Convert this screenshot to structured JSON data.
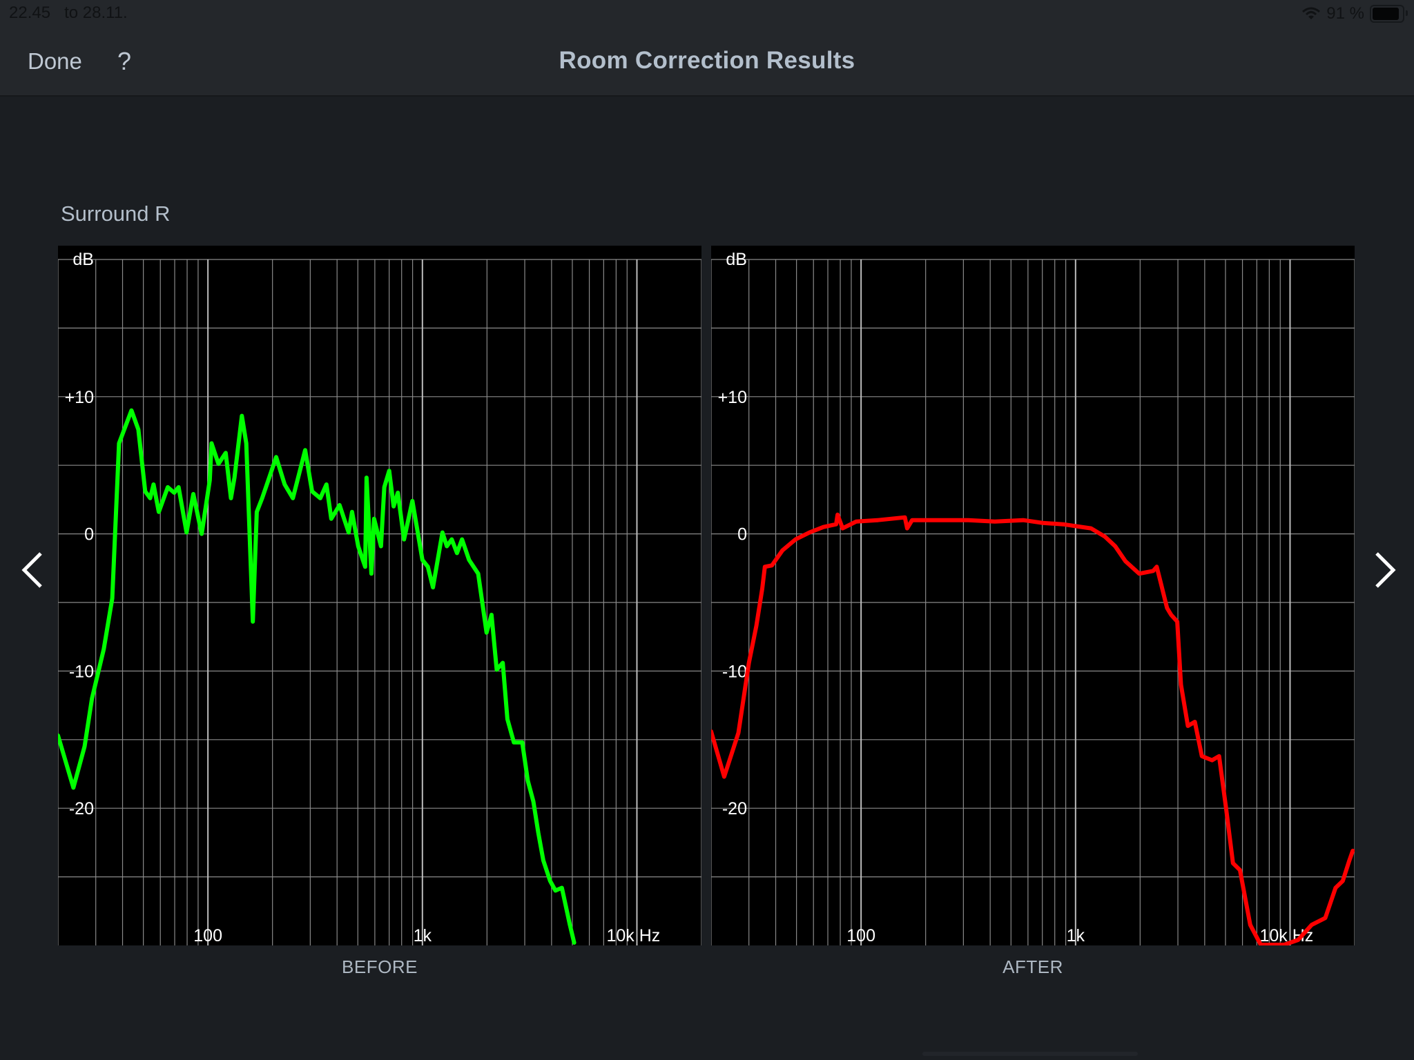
{
  "status_bar": {
    "time": "22.45",
    "date": "to 28.11.",
    "battery_percent_label": "91 %",
    "battery_level": 0.91,
    "icons": [
      "wifi-icon",
      "battery-icon"
    ]
  },
  "nav": {
    "done_label": "Done",
    "help_label": "?",
    "title": "Room Correction Results"
  },
  "channel": {
    "name": "Surround R"
  },
  "navigation": {
    "prev_icon": "chevron-left-icon",
    "next_icon": "chevron-right-icon"
  },
  "colors": {
    "before_line": "#00ff00",
    "after_line": "#ff0000",
    "grid": "#8a8a8a",
    "plot_background": "#000000"
  },
  "chart_data": [
    {
      "type": "line",
      "title": "BEFORE",
      "xlabel": "Hz",
      "ylabel": "dB",
      "xscale": "log",
      "xlim": [
        20,
        20000
      ],
      "ylim": [
        -30,
        20
      ],
      "grid": true,
      "x_ticks": [
        {
          "value": 100,
          "label": "100"
        },
        {
          "value": 1000,
          "label": "1k"
        },
        {
          "value": 10000,
          "label": "10k Hz"
        }
      ],
      "y_ticks": [
        {
          "value": 20,
          "label": "dB"
        },
        {
          "value": 10,
          "label": "+10"
        },
        {
          "value": 0,
          "label": "0"
        },
        {
          "value": -10,
          "label": "-10"
        },
        {
          "value": -20,
          "label": "-20"
        }
      ],
      "series": [
        {
          "name": "Before",
          "color": "#00ff00",
          "points": [
            [
              20,
              -14.7
            ],
            [
              23.6,
              -18.5
            ],
            [
              26.6,
              -15.5
            ],
            [
              28.8,
              -12
            ],
            [
              32.7,
              -8.4
            ],
            [
              35.8,
              -4.7
            ],
            [
              38.5,
              6.6
            ],
            [
              44,
              9.0
            ],
            [
              47.4,
              7.6
            ],
            [
              51,
              3.1
            ],
            [
              53.8,
              2.6
            ],
            [
              55.8,
              3.6
            ],
            [
              59,
              1.6
            ],
            [
              65,
              3.4
            ],
            [
              69.6,
              3.0
            ],
            [
              73,
              3.4
            ],
            [
              79.5,
              0.1
            ],
            [
              85.5,
              2.9
            ],
            [
              93.5,
              0
            ],
            [
              102,
              3.9
            ],
            [
              104,
              6.6
            ],
            [
              112,
              5.1
            ],
            [
              121,
              5.9
            ],
            [
              128,
              2.6
            ],
            [
              133,
              4.1
            ],
            [
              144,
              8.6
            ],
            [
              151,
              6.6
            ],
            [
              162,
              -6.4
            ],
            [
              169,
              1.6
            ],
            [
              179,
              2.6
            ],
            [
              193,
              4.1
            ],
            [
              208,
              5.6
            ],
            [
              228,
              3.6
            ],
            [
              249,
              2.6
            ],
            [
              284,
              6.1
            ],
            [
              306,
              3.1
            ],
            [
              334,
              2.6
            ],
            [
              357,
              3.6
            ],
            [
              376,
              1.1
            ],
            [
              411,
              2.1
            ],
            [
              453,
              0.1
            ],
            [
              470,
              1.6
            ],
            [
              502,
              -0.9
            ],
            [
              541,
              -2.4
            ],
            [
              549,
              4.1
            ],
            [
              578,
              -2.9
            ],
            [
              595,
              1.1
            ],
            [
              641,
              -0.9
            ],
            [
              664,
              3.4
            ],
            [
              700,
              4.6
            ],
            [
              734,
              2.0
            ],
            [
              768,
              3.0
            ],
            [
              821,
              -0.4
            ],
            [
              898,
              2.4
            ],
            [
              1000,
              -1.9
            ],
            [
              1060,
              -2.4
            ],
            [
              1120,
              -3.9
            ],
            [
              1240,
              0.1
            ],
            [
              1300,
              -0.9
            ],
            [
              1370,
              -0.4
            ],
            [
              1450,
              -1.4
            ],
            [
              1530,
              -0.4
            ],
            [
              1650,
              -1.9
            ],
            [
              1820,
              -2.9
            ],
            [
              1990,
              -7.2
            ],
            [
              2100,
              -5.9
            ],
            [
              2220,
              -9.9
            ],
            [
              2370,
              -9.4
            ],
            [
              2490,
              -13.5
            ],
            [
              2670,
              -15.2
            ],
            [
              2920,
              -15.2
            ],
            [
              3100,
              -18
            ],
            [
              3290,
              -19.5
            ],
            [
              3470,
              -21.8
            ],
            [
              3660,
              -23.8
            ],
            [
              3940,
              -25.3
            ],
            [
              4170,
              -26
            ],
            [
              4470,
              -25.8
            ],
            [
              4870,
              -28.5
            ],
            [
              5100,
              -29.8
            ]
          ]
        }
      ]
    },
    {
      "type": "line",
      "title": "AFTER",
      "xlabel": "Hz",
      "ylabel": "dB",
      "xscale": "log",
      "xlim": [
        20,
        20000
      ],
      "ylim": [
        -30,
        20
      ],
      "grid": true,
      "x_ticks": [
        {
          "value": 100,
          "label": "100"
        },
        {
          "value": 1000,
          "label": "1k"
        },
        {
          "value": 10000,
          "label": "10k Hz"
        }
      ],
      "y_ticks": [
        {
          "value": 20,
          "label": "dB"
        },
        {
          "value": 10,
          "label": "+10"
        },
        {
          "value": 0,
          "label": "0"
        },
        {
          "value": -10,
          "label": "-10"
        },
        {
          "value": -20,
          "label": "-20"
        }
      ],
      "series": [
        {
          "name": "After",
          "color": "#ff0000",
          "points": [
            [
              20,
              -14.4
            ],
            [
              23,
              -17.7
            ],
            [
              26.8,
              -14.5
            ],
            [
              30,
              -9.4
            ],
            [
              32.5,
              -6.7
            ],
            [
              34.6,
              -4
            ],
            [
              35.6,
              -2.4
            ],
            [
              38.4,
              -2.3
            ],
            [
              43,
              -1.2
            ],
            [
              49.5,
              -0.4
            ],
            [
              57.5,
              0.1
            ],
            [
              66.7,
              0.5
            ],
            [
              76.5,
              0.7
            ],
            [
              77.7,
              1.4
            ],
            [
              82,
              0.4
            ],
            [
              95,
              0.9
            ],
            [
              120,
              1.0
            ],
            [
              160,
              1.2
            ],
            [
              164,
              0.4
            ],
            [
              173,
              1.0
            ],
            [
              220,
              1.0
            ],
            [
              316,
              1.0
            ],
            [
              420,
              0.9
            ],
            [
              570,
              1.0
            ],
            [
              700,
              0.8
            ],
            [
              875,
              0.7
            ],
            [
              1180,
              0.4
            ],
            [
              1370,
              -0.2
            ],
            [
              1530,
              -0.9
            ],
            [
              1710,
              -2.0
            ],
            [
              1980,
              -2.9
            ],
            [
              2300,
              -2.7
            ],
            [
              2390,
              -2.4
            ],
            [
              2480,
              -3.4
            ],
            [
              2670,
              -5.4
            ],
            [
              2790,
              -5.9
            ],
            [
              2980,
              -6.4
            ],
            [
              3100,
              -11
            ],
            [
              3340,
              -14
            ],
            [
              3600,
              -13.7
            ],
            [
              3880,
              -16.2
            ],
            [
              4330,
              -16.5
            ],
            [
              4670,
              -16.2
            ],
            [
              5030,
              -20
            ],
            [
              5420,
              -24
            ],
            [
              5840,
              -24.5
            ],
            [
              6520,
              -28.5
            ],
            [
              7300,
              -30
            ],
            [
              9400,
              -30
            ],
            [
              10900,
              -29.6
            ],
            [
              12600,
              -28.5
            ],
            [
              14600,
              -28
            ],
            [
              16300,
              -25.8
            ],
            [
              17600,
              -25.3
            ],
            [
              18900,
              -23.8
            ],
            [
              19600,
              -23.1
            ]
          ]
        }
      ]
    }
  ]
}
